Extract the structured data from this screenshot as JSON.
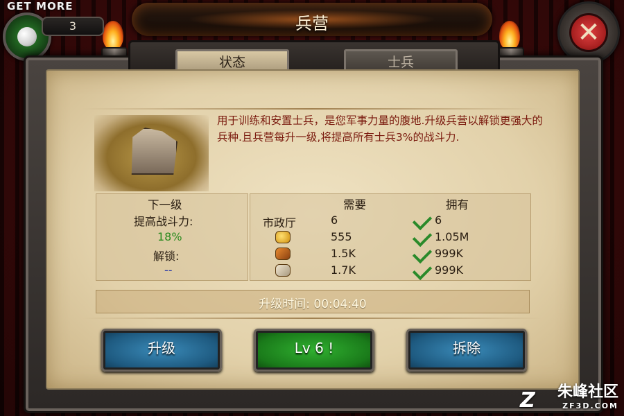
{
  "header": {
    "title": "兵营"
  },
  "get_more": {
    "label": "GET MORE",
    "count": "3"
  },
  "close_icon": "close-icon",
  "tabs": [
    {
      "label": "状态",
      "active": true
    },
    {
      "label": "士兵",
      "active": false
    }
  ],
  "description": "用于训练和安置士兵，是您军事力量的腹地.升级兵营以解锁更强大的兵种.且兵营每升一级,将提高所有士兵3%的战斗力.",
  "next_level": {
    "header": "下一级",
    "power_label": "提高战斗力:",
    "power_value": "18%",
    "unlock_label": "解锁:",
    "unlock_value": "--"
  },
  "requirements": {
    "need_header": "需要",
    "have_header": "拥有",
    "rows": [
      {
        "name": "市政厅",
        "icon": "",
        "need": "6",
        "have": "6"
      },
      {
        "name": "",
        "icon": "gold-icon",
        "need": "555",
        "have": "1.05M"
      },
      {
        "name": "",
        "icon": "wood-icon",
        "need": "1.5K",
        "have": "999K"
      },
      {
        "name": "",
        "icon": "stone-icon",
        "need": "1.7K",
        "have": "999K"
      }
    ]
  },
  "upgrade_time": "升级时间: 00:04:40",
  "buttons": {
    "upgrade": "升级",
    "level": "Lv 6 !",
    "demolish": "拆除"
  },
  "watermark": {
    "main": "朱峰社区",
    "sub": "ZF3D.COM"
  },
  "colors": {
    "desc_text": "#7a1a0e",
    "green_text": "#2a8a1e",
    "blue_button": "#1e5a80",
    "green_button": "#1a7a1a"
  }
}
